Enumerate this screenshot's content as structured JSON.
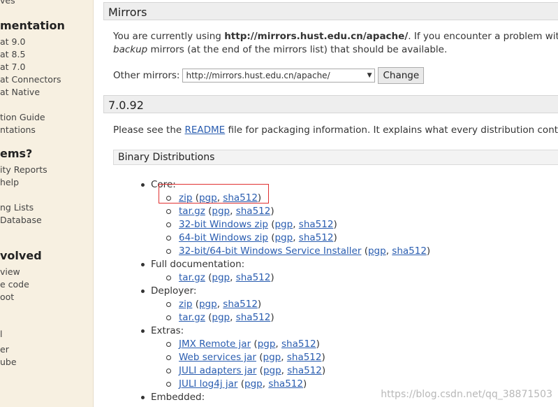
{
  "sidebar": {
    "items": [
      {
        "text": "ves",
        "type": "link"
      },
      {
        "text": "mentation",
        "type": "heading"
      },
      {
        "text": "at 9.0",
        "type": "link"
      },
      {
        "text": "at 8.5",
        "type": "link"
      },
      {
        "text": "at 7.0",
        "type": "link"
      },
      {
        "text": "at Connectors",
        "type": "link"
      },
      {
        "text": "at Native",
        "type": "link"
      },
      {
        "text": "tion Guide",
        "type": "link"
      },
      {
        "text": "ntations",
        "type": "link"
      },
      {
        "text": "ems?",
        "type": "heading"
      },
      {
        "text": "ity Reports",
        "type": "link"
      },
      {
        "text": "help",
        "type": "link"
      },
      {
        "text": "ng Lists",
        "type": "link"
      },
      {
        "text": "Database",
        "type": "link"
      },
      {
        "text": "volved",
        "type": "heading"
      },
      {
        "text": "view",
        "type": "link"
      },
      {
        "text": "e code",
        "type": "link"
      },
      {
        "text": "oot",
        "type": "link"
      },
      {
        "text": "l",
        "type": "link"
      },
      {
        "text": "er",
        "type": "link"
      },
      {
        "text": "ube",
        "type": "link"
      }
    ]
  },
  "mirrors": {
    "title": "Mirrors",
    "line1_pre": "You are currently using ",
    "line1_url": "http://mirrors.hust.edu.cn/apache/",
    "line1_post": ". If you encounter a problem with thi",
    "line2_em": "backup",
    "line2_rest": " mirrors (at the end of the mirrors list) that should be available.",
    "other_label": "Other mirrors: ",
    "select_value": "http://mirrors.hust.edu.cn/apache/",
    "change_label": "Change"
  },
  "version": {
    "title": "7.0.92",
    "readme_pre": "Please see the ",
    "readme_link": "README",
    "readme_post": " file for packaging information. It explains what every distribution contains"
  },
  "binary": {
    "title": "Binary Distributions",
    "pgp": "pgp",
    "sha": "sha512",
    "groups": [
      {
        "label": "Core:",
        "items": [
          "zip",
          "tar.gz",
          "32-bit Windows zip",
          "64-bit Windows zip",
          "32-bit/64-bit Windows Service Installer"
        ]
      },
      {
        "label": "Full documentation:",
        "items": [
          "tar.gz"
        ]
      },
      {
        "label": "Deployer:",
        "items": [
          "zip",
          "tar.gz"
        ]
      },
      {
        "label": "Extras:",
        "items": [
          "JMX Remote jar",
          "Web services jar",
          "JULI adapters jar",
          "JULI log4j jar"
        ]
      },
      {
        "label": "Embedded:",
        "items": []
      }
    ]
  },
  "watermark": "https://blog.csdn.net/qq_38871503",
  "colors": {
    "link": "#2a5db0",
    "sidebar_bg": "#f7f0e1",
    "highlight": "#e03030"
  }
}
